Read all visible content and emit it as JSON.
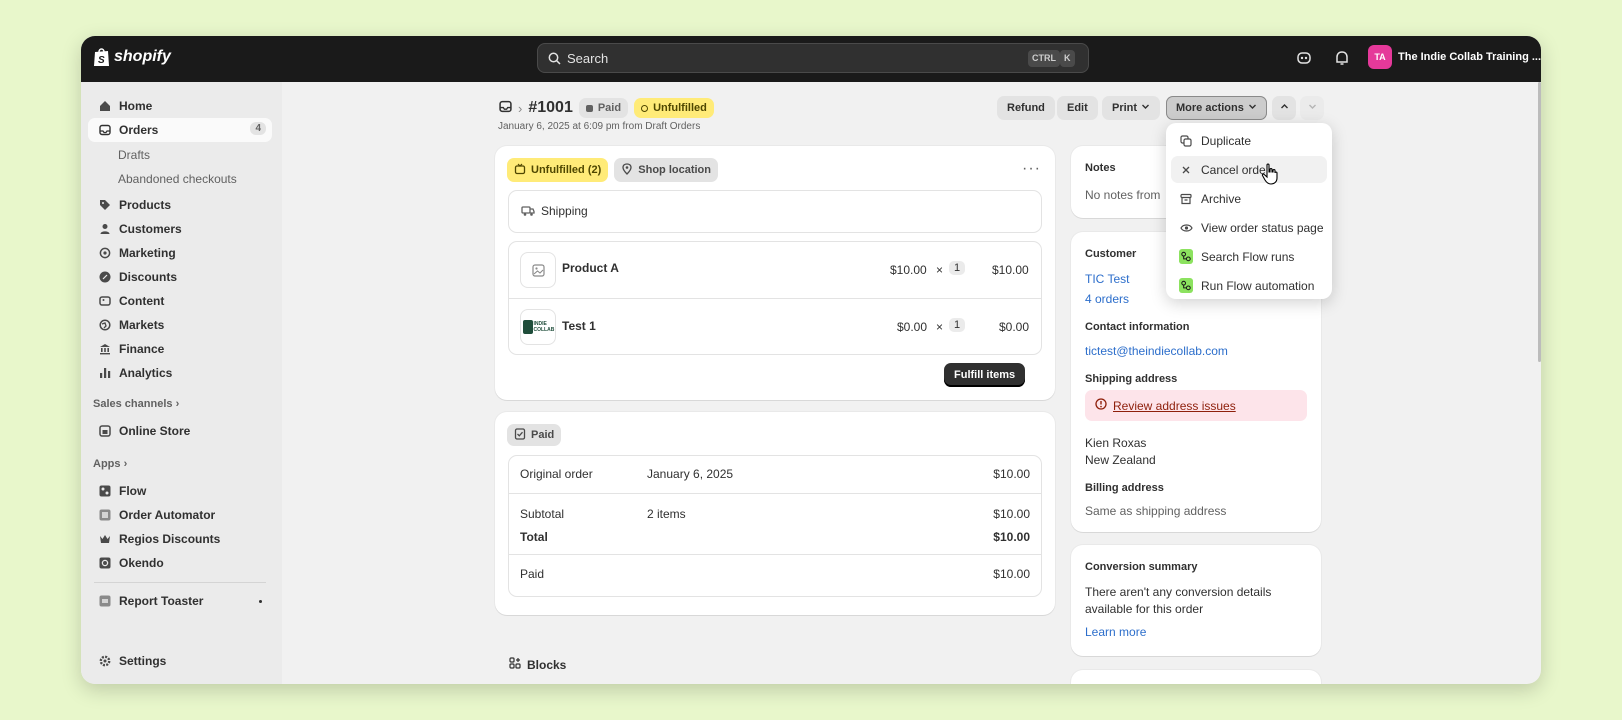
{
  "app": {
    "brand": "shopify"
  },
  "topbar": {
    "search_placeholder": "Search",
    "kbd_ctrl": "CTRL",
    "kbd_k": "K",
    "store_initials": "TA",
    "store_name": "The Indie Collab Training ..."
  },
  "sidebar": {
    "home": "Home",
    "orders": "Orders",
    "orders_count": "4",
    "drafts": "Drafts",
    "abandoned": "Abandoned checkouts",
    "products": "Products",
    "customers": "Customers",
    "marketing": "Marketing",
    "discounts": "Discounts",
    "content": "Content",
    "markets": "Markets",
    "finance": "Finance",
    "analytics": "Analytics",
    "sales_channels": "Sales channels",
    "online_store": "Online Store",
    "apps": "Apps",
    "flow": "Flow",
    "order_automator": "Order Automator",
    "regios": "Regios Discounts",
    "okendo": "Okendo",
    "report_toaster": "Report Toaster",
    "settings": "Settings"
  },
  "order": {
    "number": "#1001",
    "payment_badge": "Paid",
    "fulfillment_badge": "Unfulfilled",
    "subtitle": "January 6, 2025 at 6:09 pm from Draft Orders"
  },
  "header_actions": {
    "refund": "Refund",
    "edit": "Edit",
    "print": "Print",
    "more_actions": "More actions"
  },
  "more_actions_menu": [
    {
      "label": "Duplicate"
    },
    {
      "label": "Cancel order"
    },
    {
      "label": "Archive"
    },
    {
      "label": "View order status page"
    },
    {
      "label": "Search Flow runs"
    },
    {
      "label": "Run Flow automation"
    }
  ],
  "fulfillment_card": {
    "status_pill": "Unfulfilled (2)",
    "location_pill": "Shop location",
    "delivery_method": "Shipping",
    "items": [
      {
        "name": "Product A",
        "price": "$10.00",
        "times": "×",
        "qty": "1",
        "total": "$10.00"
      },
      {
        "name": "Test 1",
        "price": "$0.00",
        "times": "×",
        "qty": "1",
        "total": "$0.00"
      }
    ],
    "fulfill_button": "Fulfill items",
    "test_logo_text": "INDIE COLLAB"
  },
  "payment_card": {
    "status_pill": "Paid",
    "original_order_label": "Original order",
    "original_order_date": "January 6, 2025",
    "original_order_amount": "$10.00",
    "subtotal_label": "Subtotal",
    "subtotal_items": "2 items",
    "subtotal_amount": "$10.00",
    "total_label": "Total",
    "total_amount": "$10.00",
    "paid_label": "Paid",
    "paid_amount": "$10.00"
  },
  "blocks_label": "Blocks",
  "notes": {
    "title": "Notes",
    "text": "No notes from"
  },
  "customer": {
    "title": "Customer",
    "name": "TIC Test",
    "orders": "4 orders",
    "contact_title": "Contact information",
    "email": "tictest@theindiecollab.com",
    "shipping_title": "Shipping address",
    "review_link": "Review address issues",
    "address_line1": "Kien Roxas",
    "address_line2": "New Zealand",
    "billing_title": "Billing address",
    "billing_text": "Same as shipping address"
  },
  "conversion": {
    "title": "Conversion summary",
    "text_line1": "There aren't any conversion details",
    "text_line2": "available for this order",
    "link": "Learn more"
  },
  "colors": {
    "accent_link": "#2c6ecb",
    "unfulfilled_yellow": "#ffeb78",
    "topbar": "#1a1a1a",
    "alert_pink": "#fde4ea"
  }
}
